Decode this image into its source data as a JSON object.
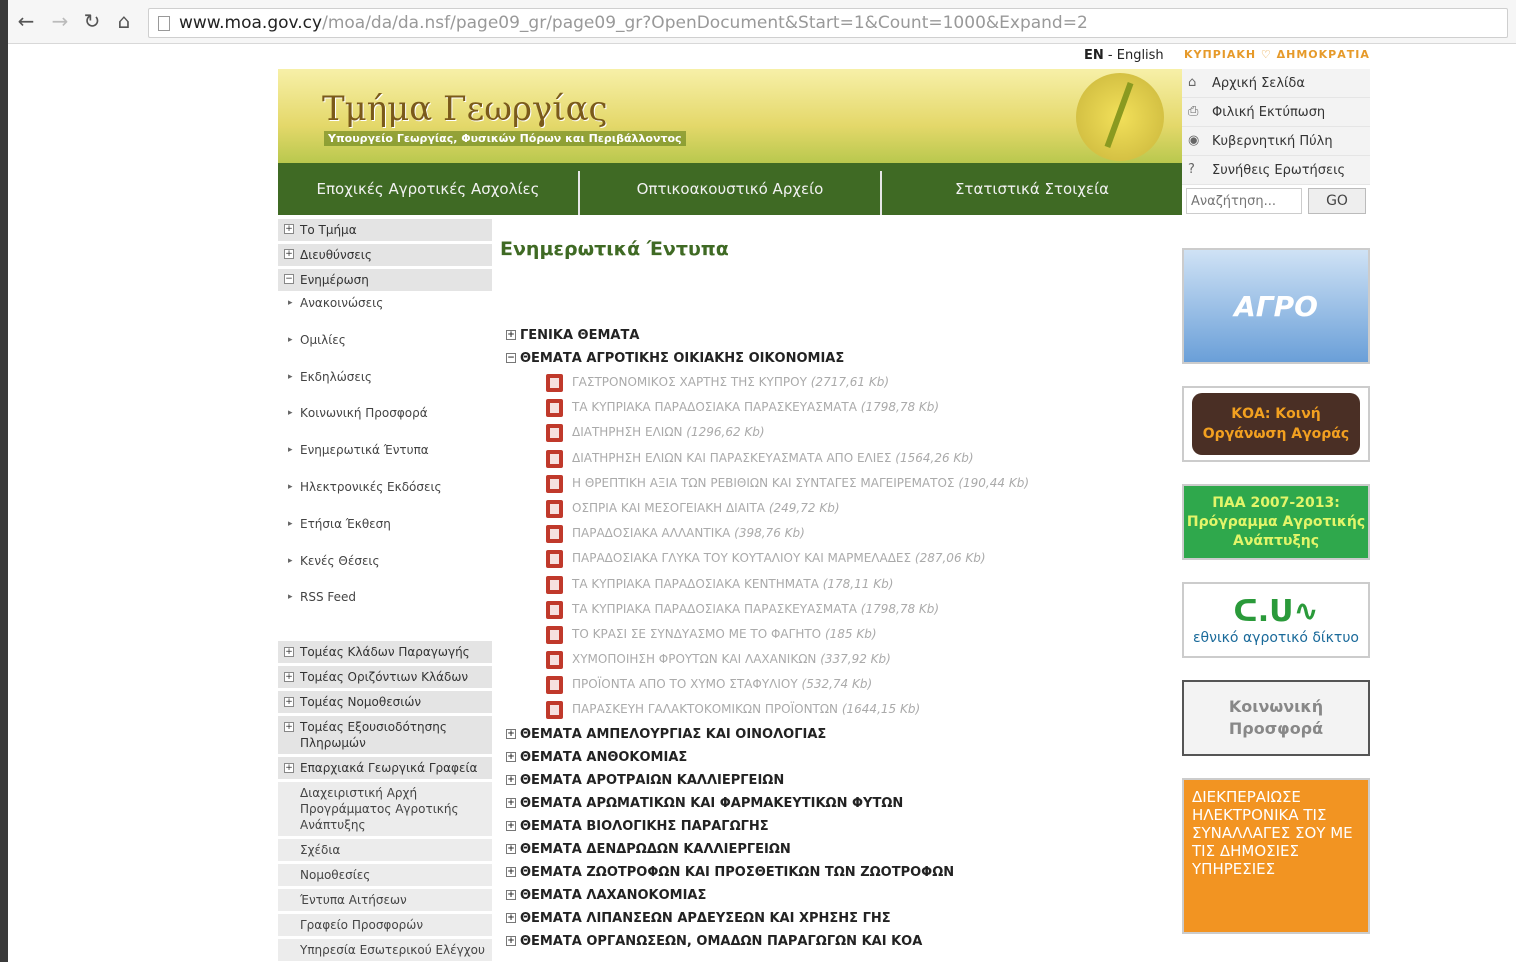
{
  "browser": {
    "url_domain": "www.moa.gov.cy",
    "url_path": "/moa/da/da.nsf/page09_gr/page09_gr?OpenDocument&Start=1&Count=1000&Expand=2"
  },
  "header": {
    "lang_code": "EN",
    "lang_sep": " - ",
    "lang_name": "English",
    "gov": "ΚΥΠΡΙΑΚΗ ♡ ΔΗΜΟΚΡΑΤΙΑ",
    "title": "Τμήμα Γεωργίας",
    "subtitle": "Υπουργείο Γεωργίας, Φυσικών Πόρων και Περιβάλλοντος",
    "nav": [
      "Εποχικές Αγροτικές Ασχολίες",
      "Οπτικοακουστικό Αρχείο",
      "Στατιστικά Στοιχεία"
    ]
  },
  "toplinks": [
    {
      "label": "Αρχική Σελίδα",
      "icon": "home-icon"
    },
    {
      "label": "Φιλική Εκτύπωση",
      "icon": "print-icon"
    },
    {
      "label": "Κυβερνητική Πύλη",
      "icon": "globe-icon"
    },
    {
      "label": "Συνήθεις Ερωτήσεις",
      "icon": "question-icon"
    }
  ],
  "search": {
    "placeholder": "Αναζήτηση...",
    "button": "GO"
  },
  "leftnav": {
    "main": [
      {
        "label": "Το Τμήμα",
        "state": "+"
      },
      {
        "label": "Διευθύνσεις",
        "state": "+"
      },
      {
        "label": "Ενημέρωση",
        "state": "−"
      }
    ],
    "sub": [
      "Ανακοινώσεις",
      "Ομιλίες",
      "Εκδηλώσεις",
      "Κοινωνική Προσφορά",
      "Ενημερωτικά Έντυπα",
      "Ηλεκτρονικές Εκδόσεις",
      "Ετήσια Έκθεση",
      "Κενές Θέσεις",
      "RSS Feed"
    ],
    "sections": [
      "Τομέας Κλάδων Παραγωγής",
      "Τομέας Οριζόντιων Κλάδων",
      "Τομέας Νομοθεσιών",
      "Τομέας Εξουσιοδότησης Πληρωμών",
      "Επαρχιακά Γεωργικά Γραφεία"
    ],
    "links": [
      "Διαχειριστική Αρχή Προγράμματος Αγροτικής Ανάπτυξης",
      "Σχέδια",
      "Νομοθεσίες",
      "Έντυπα Αιτήσεων",
      "Γραφείο Προσφορών",
      "Υπηρεσία Εσωτερικού Ελέγχου"
    ]
  },
  "main": {
    "title": "Ενημερωτικά Έντυπα",
    "topics_before": [
      {
        "label": "ΓΕΝΙΚΑ ΘΕΜΑΤΑ",
        "state": "+"
      },
      {
        "label": "ΘΕΜΑΤΑ ΑΓΡΟΤΙΚΗΣ ΟΙΚΙΑΚΗΣ ΟΙΚΟΝΟΜΙΑΣ",
        "state": "−"
      }
    ],
    "documents": [
      {
        "title": "ΓΑΣΤΡΟΝΟΜΙΚΟΣ ΧΑΡΤΗΣ ΤΗΣ ΚΥΠΡΟΥ",
        "size": "(2717,61 Kb)"
      },
      {
        "title": "ΤΑ ΚΥΠΡΙΑΚΑ ΠΑΡΑΔΟΣΙΑΚΑ ΠΑΡΑΣΚΕΥΑΣΜΑΤΑ",
        "size": "(1798,78 Kb)"
      },
      {
        "title": "ΔΙΑΤΗΡΗΣΗ ΕΛΙΩΝ",
        "size": "(1296,62 Kb)"
      },
      {
        "title": "ΔΙΑΤΗΡΗΣΗ ΕΛΙΩΝ ΚΑΙ ΠΑΡΑΣΚΕΥΑΣΜΑΤΑ ΑΠΟ ΕΛΙΕΣ",
        "size": "(1564,26 Kb)"
      },
      {
        "title": "Η ΘΡΕΠΤΙΚΗ ΑΞΙΑ ΤΩΝ ΡΕΒΙΘΙΩΝ ΚΑΙ ΣΥΝΤΑΓΕΣ ΜΑΓΕΙΡΕΜΑΤΟΣ",
        "size": "(190,44 Kb)"
      },
      {
        "title": "ΟΣΠΡΙΑ ΚΑΙ ΜΕΣΟΓΕΙΑΚΗ ΔΙΑΙΤΑ",
        "size": "(249,72 Kb)"
      },
      {
        "title": "ΠΑΡΑΔΟΣΙΑΚΑ ΑΛΛΑΝΤΙΚΑ",
        "size": "(398,76 Kb)"
      },
      {
        "title": "ΠΑΡΑΔΟΣΙΑΚΑ ΓΛΥΚΑ ΤΟΥ ΚΟΥΤΑΛΙΟΥ ΚΑΙ ΜΑΡΜΕΛΑΔΕΣ",
        "size": "(287,06 Kb)"
      },
      {
        "title": "ΤΑ ΚΥΠΡΙΑΚΑ ΠΑΡΑΔΟΣΙΑΚΑ ΚΕΝΤΗΜΑΤΑ",
        "size": "(178,11 Kb)"
      },
      {
        "title": "ΤΑ ΚΥΠΡΙΑΚΑ ΠΑΡΑΔΟΣΙΑΚΑ ΠΑΡΑΣΚΕΥΑΣΜΑΤΑ",
        "size": "(1798,78 Kb)"
      },
      {
        "title": "ΤΟ ΚΡΑΣΙ ΣΕ ΣΥΝΔΥΑΣΜΟ ΜΕ ΤΟ ΦΑΓΗΤΟ",
        "size": "(185 Kb)"
      },
      {
        "title": "ΧΥΜΟΠΟΙΗΣΗ ΦΡΟΥΤΩΝ ΚΑΙ ΛΑΧΑΝΙΚΩΝ",
        "size": "(337,92 Kb)"
      },
      {
        "title": "ΠΡΟΪΟΝΤΑ ΑΠΟ ΤΟ ΧΥΜΟ ΣΤΑΦΥΛΙΟΥ",
        "size": "(532,74 Kb)"
      },
      {
        "title": "ΠΑΡΑΣΚΕΥΗ ΓΑΛΑΚΤΟΚΟΜΙΚΩΝ ΠΡΟΪΟΝΤΩΝ",
        "size": "(1644,15 Kb)"
      }
    ],
    "topics_after": [
      {
        "label": "ΘΕΜΑΤΑ ΑΜΠΕΛΟΥΡΓΙΑΣ ΚΑΙ ΟΙΝΟΛΟΓΙΑΣ",
        "state": "+"
      },
      {
        "label": "ΘΕΜΑΤΑ ΑΝΘΟΚΟΜΙΑΣ",
        "state": "+"
      },
      {
        "label": "ΘΕΜΑΤΑ ΑΡΟΤΡΑΙΩΝ ΚΑΛΛΙΕΡΓΕΙΩΝ",
        "state": "+"
      },
      {
        "label": "ΘΕΜΑΤΑ ΑΡΩΜΑΤΙΚΩΝ ΚΑΙ ΦΑΡΜΑΚΕΥΤΙΚΩΝ ΦΥΤΩΝ",
        "state": "+"
      },
      {
        "label": "ΘΕΜΑΤΑ ΒΙΟΛΟΓΙΚΗΣ ΠΑΡΑΓΩΓΗΣ",
        "state": "+"
      },
      {
        "label": "ΘΕΜΑΤΑ ΔΕΝΔΡΩΔΩΝ ΚΑΛΛΙΕΡΓΕΙΩΝ",
        "state": "+"
      },
      {
        "label": "ΘΕΜΑΤΑ ΖΩΟΤΡΟΦΩΝ ΚΑΙ ΠΡΟΣΘΕΤΙΚΩΝ ΤΩΝ ΖΩΟΤΡΟΦΩΝ",
        "state": "+"
      },
      {
        "label": "ΘΕΜΑΤΑ ΛΑΧΑΝΟΚΟΜΙΑΣ",
        "state": "+"
      },
      {
        "label": "ΘΕΜΑΤΑ ΛΙΠΑΝΣΕΩΝ ΑΡΔΕΥΣΕΩΝ ΚΑΙ ΧΡΗΣΗΣ ΓΗΣ",
        "state": "+"
      },
      {
        "label": "ΘΕΜΑΤΑ ΟΡΓΑΝΩΣΕΩΝ, ΟΜΑΔΩΝ ΠΑΡΑΓΩΓΩΝ ΚΑΙ ΚΟΑ",
        "state": "+"
      }
    ]
  },
  "right": {
    "agro": "ΑΓΡΟ",
    "koa": "ΚΟΑ: Κοινή Οργάνωση Αγοράς",
    "paa": "ΠΑΑ 2007-2013: Πρόγραμμα Αγροτικής Ανάπτυξης",
    "enad_logo": "ᑕ.ᑌ∿",
    "enad_text": "εθνικό αγροτικό δίκτυο",
    "koinoniki": "Κοινωνική Προσφορά",
    "efc": "ΔΙΕΚΠΕΡΑΙΩΣΕ ΗΛΕΚΤΡΟΝΙΚΑ ΤΙΣ ΣΥΝΑΛΛΑΓΕΣ ΣΟΥ ΜΕ ΤΙΣ ΔΗΜΟΣΙΕΣ ΥΠΗΡΕΣΙΕΣ"
  }
}
